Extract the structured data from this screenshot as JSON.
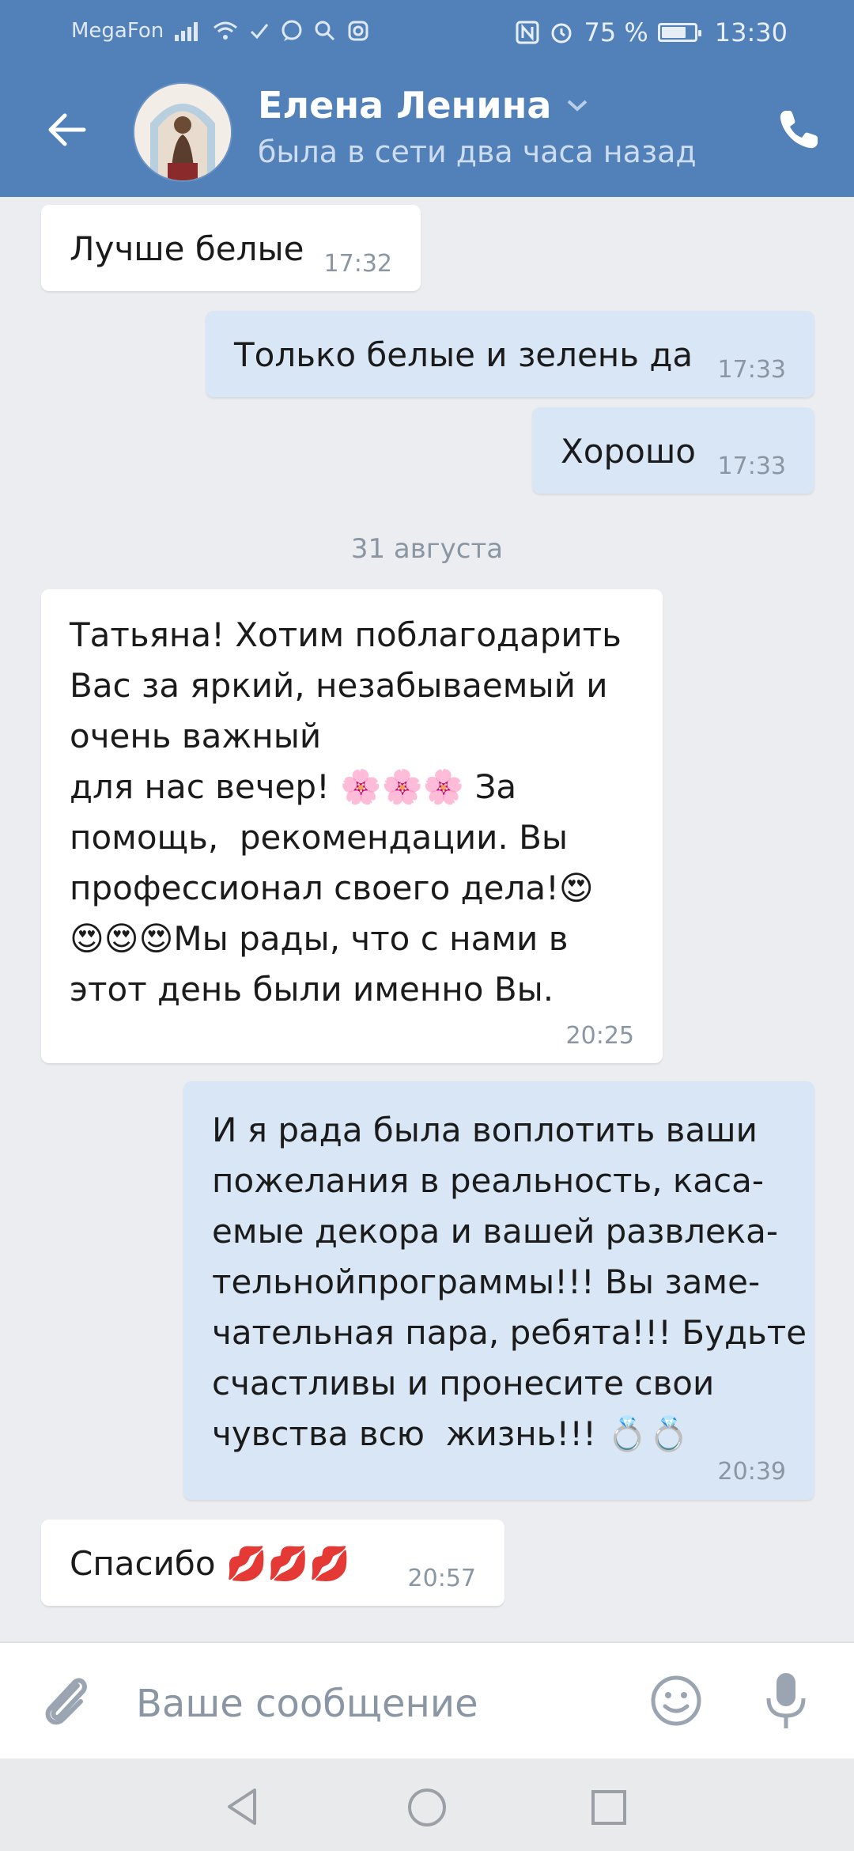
{
  "status_bar": {
    "carrier": "MegaFon",
    "battery": "75 %",
    "battery_level": 0.75,
    "time": "13:30"
  },
  "header": {
    "contact_name": "Елена Ленина",
    "status": "была в сети два часа назад"
  },
  "messages": [
    {
      "direction": "in",
      "text": "Лучше белые",
      "time": "17:32"
    },
    {
      "direction": "out",
      "text": "Только белые и зелень да",
      "time": "17:33"
    },
    {
      "direction": "out",
      "text": "Хорошо",
      "time": "17:33"
    },
    {
      "direction": "in",
      "text": "Татьяна! Хотим поблагодарить\nВас за яркий, незабываемый и\nочень важный\nдля нас вечер! 🌸🌸🌸 За\nпомощь,  рекомендации. Вы\nпрофессионал своего дела!😍\n😍😍😍Мы рады, что с нами в\nэтот день были именно Вы.",
      "time": "20:25"
    },
    {
      "direction": "out",
      "text": "И я рада была воплотить ваши\nпожелания в реальность, каса-\nемые декора и вашей развлека-\nтельнойпрограммы!!! Вы заме-\nчательная пара, ребята!!! Будьте\nсчастливы и пронесите свои\nчувства всю  жизнь!!! 💍💍",
      "time": "20:39"
    },
    {
      "direction": "in",
      "text": "Спасибо 💋💋💋",
      "time": "20:57"
    }
  ],
  "date_separator": "31 августа",
  "input": {
    "placeholder": "Ваше сообщение"
  },
  "colors": {
    "header_bg": "#5181b8",
    "incoming_bg": "#ffffff",
    "outgoing_bg": "#d9e6f5",
    "chat_bg": "#ebedf0"
  },
  "icons": [
    "back-arrow-icon",
    "chevron-down-icon",
    "phone-icon",
    "paperclip-icon",
    "smile-icon",
    "microphone-icon",
    "nav-back-icon",
    "nav-home-icon",
    "nav-recents-icon"
  ]
}
